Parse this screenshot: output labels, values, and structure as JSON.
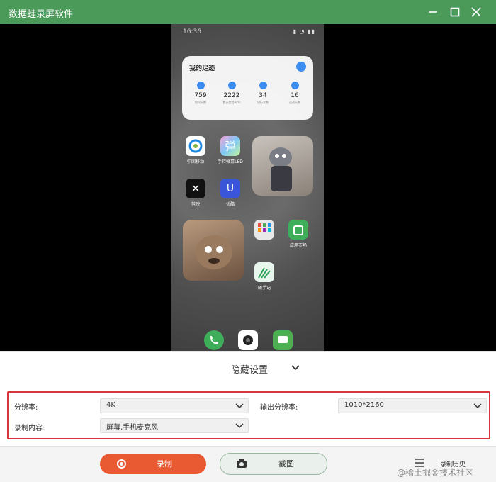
{
  "window": {
    "title": "数据蛙录屏软件"
  },
  "phone": {
    "status_time": "16:36",
    "widget": {
      "title": "我的足迹",
      "stats": [
        {
          "value": "759",
          "label": "陪伴天数"
        },
        {
          "value": "2222",
          "label": "累计里程(km)"
        },
        {
          "value": "34",
          "label": "出行次数"
        },
        {
          "value": "16",
          "label": "运动天数"
        }
      ]
    },
    "apps": [
      {
        "label": "中国移动"
      },
      {
        "label": "手持弹幕LED"
      },
      {
        "label": "剪映"
      },
      {
        "label": "优酷"
      },
      {
        "label": "应用市场"
      },
      {
        "label": "随手记"
      }
    ]
  },
  "panel": {
    "hide_settings_label": "隐藏设置"
  },
  "settings": {
    "resolution_label": "分辨率:",
    "resolution_value": "4K",
    "output_resolution_label": "输出分辨率:",
    "output_resolution_value": "1010*2160",
    "content_label": "录制内容:",
    "content_value": "屏幕,手机麦克风"
  },
  "actions": {
    "record_label": "录制",
    "screenshot_label": "截图",
    "history_label": "录制历史",
    "watermark": "@稀土掘金技术社区"
  },
  "colors": {
    "titlebar": "#4b9a5a",
    "record": "#e95a33",
    "highlight": "#d9363e"
  }
}
